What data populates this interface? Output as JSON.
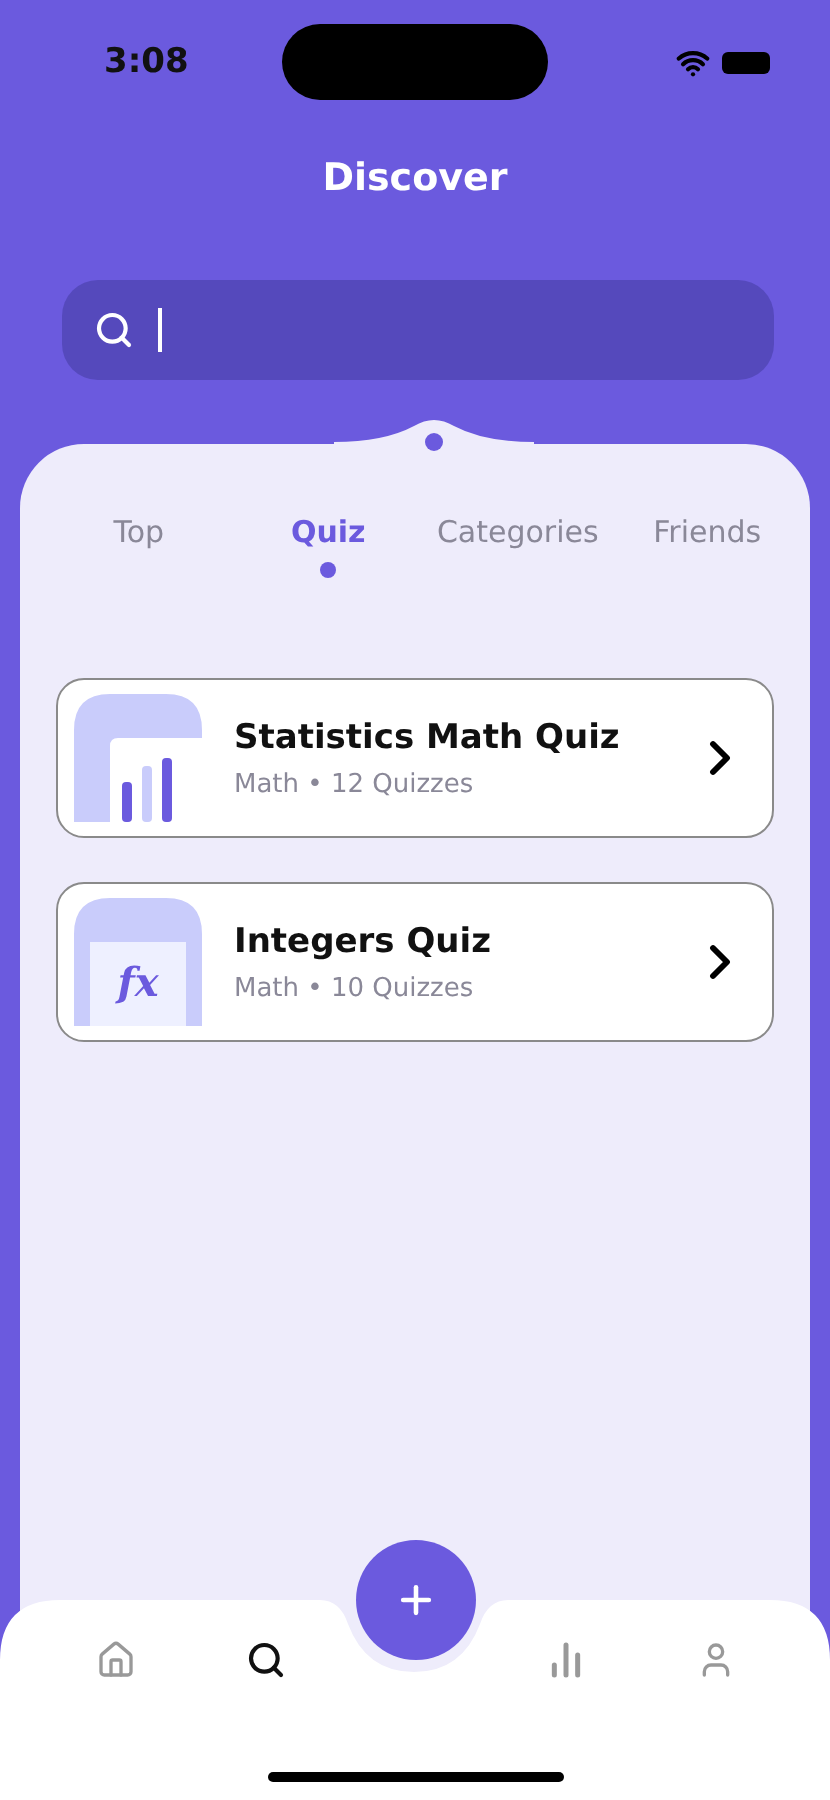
{
  "status_bar": {
    "time": "3:08"
  },
  "header": {
    "title": "Discover"
  },
  "search": {
    "focused": true
  },
  "tabs": [
    {
      "label": "Top",
      "selected": false
    },
    {
      "label": "Quiz",
      "selected": true
    },
    {
      "label": "Categories",
      "selected": false
    },
    {
      "label": "Friends",
      "selected": false
    }
  ],
  "quizzes": [
    {
      "title": "Statistics Math Quiz",
      "subtitle": "Math • 12 Quizzes",
      "kind": "chart"
    },
    {
      "title": "Integers Quiz",
      "subtitle": "Math • 10 Quizzes",
      "kind": "function",
      "symbol": "fx"
    }
  ],
  "nav": [
    {
      "kind": "home",
      "selected": false
    },
    {
      "kind": "search",
      "selected": true
    },
    {
      "kind": "add"
    },
    {
      "kind": "stats",
      "selected": false
    },
    {
      "kind": "profile",
      "selected": false
    }
  ]
}
